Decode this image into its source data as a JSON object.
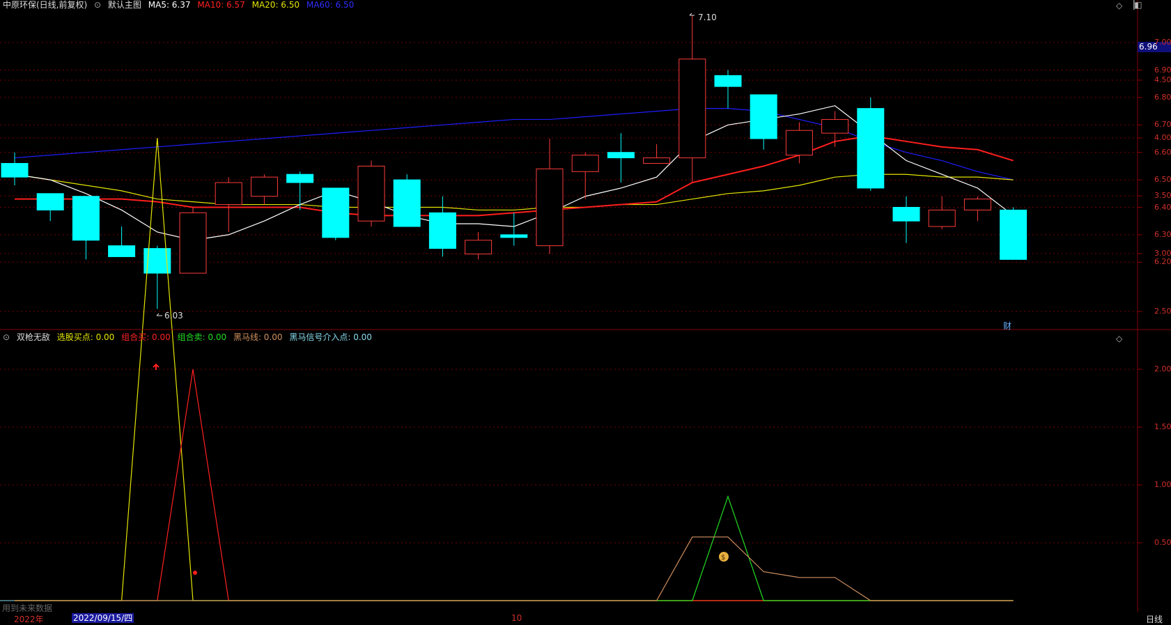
{
  "main_header": {
    "stock_title": "中原环保(日线,前复权)",
    "template_label": "默认主图",
    "ma5": "MA5: 6.37",
    "ma10": "MA10: 6.57",
    "ma20": "MA20: 6.50",
    "ma60": "MA60: 6.50"
  },
  "sub_header": {
    "indicator_name": "双枪无敌",
    "buy_point": "选股买点: 0.00",
    "combo_buy": "组合买: 0.00",
    "combo_sell": "组合卖: 0.00",
    "dark_horse": "黑马线: 0.00",
    "dark_horse_entry": "黑马信号介入点: 0.00"
  },
  "current_price_tag": "6.96",
  "high_marker": "7.10",
  "low_marker": "6.03",
  "finance_marker": "财",
  "future_data_note": "用到未来数据",
  "period_label": "日线",
  "date_axis": {
    "year": "2022年",
    "selected_date": "2022/09/15/四",
    "month": "10"
  },
  "colors": {
    "up": "#ff3b3b",
    "down": "#00ffff",
    "ma5": "#ffffff",
    "ma10": "#ff1e1e",
    "ma20": "#e5e500",
    "ma60": "#1e1eff",
    "grid": "#7a0000"
  },
  "chart_data": [
    {
      "type": "candlestick",
      "title": "中原环保(日线,前复权)",
      "y_ticks": [
        "7.00",
        "6.90",
        "6.80",
        "6.70",
        "6.60",
        "6.50",
        "6.40",
        "6.30",
        "6.20"
      ],
      "ylim": [
        6.03,
        7.1
      ],
      "candles": [
        {
          "o": 6.51,
          "c": 6.56,
          "h": 6.6,
          "l": 6.48,
          "dir": "down"
        },
        {
          "o": 6.45,
          "c": 6.39,
          "h": 6.45,
          "l": 6.35,
          "dir": "down"
        },
        {
          "o": 6.44,
          "c": 6.28,
          "h": 6.44,
          "l": 6.21,
          "dir": "down"
        },
        {
          "o": 6.26,
          "c": 6.22,
          "h": 6.33,
          "l": 6.22,
          "dir": "down"
        },
        {
          "o": 6.25,
          "c": 6.16,
          "h": 6.26,
          "l": 6.03,
          "dir": "down"
        },
        {
          "o": 6.16,
          "c": 6.38,
          "h": 6.4,
          "l": 6.16,
          "dir": "up"
        },
        {
          "o": 6.41,
          "c": 6.49,
          "h": 6.51,
          "l": 6.31,
          "dir": "up"
        },
        {
          "o": 6.44,
          "c": 6.51,
          "h": 6.52,
          "l": 6.41,
          "dir": "up"
        },
        {
          "o": 6.52,
          "c": 6.49,
          "h": 6.53,
          "l": 6.39,
          "dir": "down"
        },
        {
          "o": 6.47,
          "c": 6.29,
          "h": 6.47,
          "l": 6.28,
          "dir": "down"
        },
        {
          "o": 6.35,
          "c": 6.55,
          "h": 6.57,
          "l": 6.33,
          "dir": "up"
        },
        {
          "o": 6.5,
          "c": 6.33,
          "h": 6.52,
          "l": 6.33,
          "dir": "down"
        },
        {
          "o": 6.38,
          "c": 6.25,
          "h": 6.44,
          "l": 6.22,
          "dir": "down"
        },
        {
          "o": 6.23,
          "c": 6.28,
          "h": 6.31,
          "l": 6.21,
          "dir": "up"
        },
        {
          "o": 6.3,
          "c": 6.29,
          "h": 6.38,
          "l": 6.26,
          "dir": "down"
        },
        {
          "o": 6.26,
          "c": 6.54,
          "h": 6.65,
          "l": 6.23,
          "dir": "up"
        },
        {
          "o": 6.53,
          "c": 6.59,
          "h": 6.6,
          "l": 6.43,
          "dir": "up"
        },
        {
          "o": 6.6,
          "c": 6.58,
          "h": 6.67,
          "l": 6.49,
          "dir": "down"
        },
        {
          "o": 6.56,
          "c": 6.58,
          "h": 6.63,
          "l": 6.56,
          "dir": "up"
        },
        {
          "o": 6.58,
          "c": 6.94,
          "h": 7.1,
          "l": 6.49,
          "dir": "up"
        },
        {
          "o": 6.88,
          "c": 6.84,
          "h": 6.9,
          "l": 6.76,
          "dir": "down"
        },
        {
          "o": 6.81,
          "c": 6.65,
          "h": 6.81,
          "l": 6.61,
          "dir": "down"
        },
        {
          "o": 6.59,
          "c": 6.68,
          "h": 6.71,
          "l": 6.56,
          "dir": "up"
        },
        {
          "o": 6.67,
          "c": 6.72,
          "h": 6.75,
          "l": 6.62,
          "dir": "up"
        },
        {
          "o": 6.76,
          "c": 6.47,
          "h": 6.8,
          "l": 6.46,
          "dir": "down"
        },
        {
          "o": 6.4,
          "c": 6.35,
          "h": 6.44,
          "l": 6.27,
          "dir": "down"
        },
        {
          "o": 6.33,
          "c": 6.39,
          "h": 6.44,
          "l": 6.32,
          "dir": "up"
        },
        {
          "o": 6.39,
          "c": 6.43,
          "h": 6.44,
          "l": 6.35,
          "dir": "up"
        },
        {
          "o": 6.39,
          "c": 6.21,
          "h": 6.4,
          "l": 6.21,
          "dir": "down"
        }
      ],
      "ma5": [
        6.52,
        6.5,
        6.45,
        6.39,
        6.31,
        6.28,
        6.3,
        6.35,
        6.41,
        6.46,
        6.42,
        6.37,
        6.34,
        6.34,
        6.33,
        6.38,
        6.44,
        6.47,
        6.51,
        6.64,
        6.7,
        6.72,
        6.74,
        6.77,
        6.67,
        6.57,
        6.52,
        6.47,
        6.37
      ],
      "ma10": [
        6.43,
        6.43,
        6.43,
        6.43,
        6.42,
        6.4,
        6.4,
        6.4,
        6.4,
        6.38,
        6.37,
        6.37,
        6.37,
        6.37,
        6.38,
        6.39,
        6.4,
        6.41,
        6.42,
        6.49,
        6.52,
        6.55,
        6.59,
        6.64,
        6.66,
        6.64,
        6.62,
        6.61,
        6.57
      ],
      "ma20": [
        6.52,
        6.5,
        6.48,
        6.46,
        6.43,
        6.42,
        6.41,
        6.41,
        6.41,
        6.4,
        6.4,
        6.4,
        6.4,
        6.39,
        6.39,
        6.4,
        6.4,
        6.41,
        6.41,
        6.43,
        6.45,
        6.46,
        6.48,
        6.51,
        6.52,
        6.52,
        6.51,
        6.51,
        6.5
      ],
      "ma60": [
        6.58,
        6.59,
        6.6,
        6.61,
        6.62,
        6.63,
        6.64,
        6.65,
        6.66,
        6.67,
        6.68,
        6.69,
        6.7,
        6.71,
        6.72,
        6.72,
        6.73,
        6.74,
        6.75,
        6.76,
        6.76,
        6.75,
        6.72,
        6.69,
        6.64,
        6.6,
        6.57,
        6.53,
        6.5
      ]
    },
    {
      "type": "line",
      "title": "双枪无敌",
      "y_ticks": [
        "4.50",
        "4.00",
        "3.50",
        "3.00",
        "2.50",
        "2.00",
        "1.50",
        "1.00",
        "0.50"
      ],
      "ylim": [
        0,
        4.7
      ],
      "series": [
        {
          "name": "选股买点",
          "values": [
            0,
            0,
            0,
            0,
            4,
            0,
            0,
            0,
            0,
            0,
            0,
            0,
            0,
            0,
            0,
            0,
            0,
            0,
            0,
            0,
            0,
            0,
            0,
            0,
            0,
            0,
            0,
            0,
            0
          ]
        },
        {
          "name": "组合买",
          "values": [
            0,
            0,
            0,
            0,
            0,
            2,
            0,
            0,
            0,
            0,
            0,
            0,
            0,
            0,
            0,
            0,
            0,
            0,
            0,
            0,
            0,
            0,
            0,
            0,
            0,
            0,
            0,
            0,
            0
          ]
        },
        {
          "name": "组合卖",
          "values": [
            0,
            0,
            0,
            0,
            0,
            0,
            0,
            0,
            0,
            0,
            0,
            0,
            0,
            0,
            0,
            0,
            0,
            0,
            0,
            0,
            0.9,
            0,
            0,
            0,
            0,
            0,
            0,
            0,
            0
          ]
        },
        {
          "name": "黑马线",
          "values": [
            0,
            0,
            0,
            0,
            0,
            0,
            0,
            0,
            0,
            0,
            0,
            0,
            0,
            0,
            0,
            0,
            0,
            0,
            0,
            0.55,
            0.55,
            0.25,
            0.2,
            0.2,
            0,
            0,
            0,
            0,
            0
          ]
        },
        {
          "name": "黑马信号介入点",
          "values": [
            0,
            0,
            0,
            0,
            0,
            0,
            0,
            0,
            0,
            0,
            0,
            0,
            0,
            0,
            0,
            0,
            0,
            0,
            0,
            0,
            0,
            0,
            0,
            0,
            0,
            0,
            0,
            0,
            0
          ]
        }
      ]
    }
  ]
}
